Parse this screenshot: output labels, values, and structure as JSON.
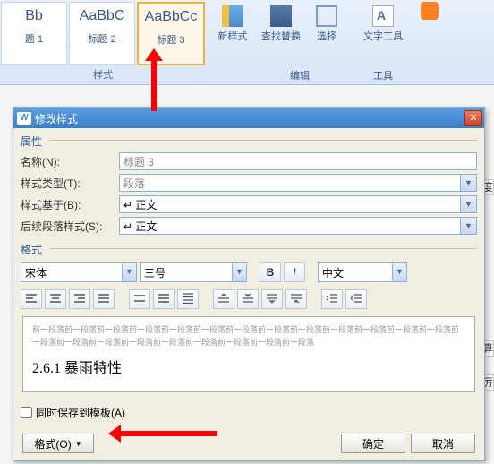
{
  "ribbon": {
    "styles": [
      {
        "sample": "Bb",
        "label": "题 1"
      },
      {
        "sample": "AaBbC",
        "label": "标题 2"
      },
      {
        "sample": "AaBbCc",
        "label": "标题 3"
      }
    ],
    "styles_group_label": "样式",
    "newstyle": "新样式",
    "findreplace": "查找替换",
    "select": "选择",
    "texttool": "文字工具",
    "edit_group": "编辑",
    "tool_group": "工具"
  },
  "dialog": {
    "title": "修改样式",
    "section_attr": "属性",
    "name_label": "名称(N):",
    "name_value": "标题 3",
    "styletype_label": "样式类型(T):",
    "styletype_value": "段落",
    "basedon_label": "样式基于(B):",
    "basedon_value": "↵ 正文",
    "followstyle_label": "后续段落样式(S):",
    "followstyle_value": "↵ 正文",
    "section_fmt": "格式",
    "font_value": "宋体",
    "size_value": "三号",
    "bold": "B",
    "italic": "I",
    "lang_value": "中文",
    "preview_filler": "前一段落前一段落前一段落前一段落前一段落前一段落前一段落前一段落前一段落前一段落前一段落前一段落前一段落前一段落前一段落前一段落前一段落前一段落前一段落前一段落前一段落前一段落",
    "preview_heading": "2.6.1 暴雨特性",
    "save_template": "同时保存到模板(A)",
    "format_btn": "格式(O)",
    "ok": "确定",
    "cancel": "取消"
  },
  "bg": {
    "c1": "度",
    "c2": "算",
    "c3": "厉"
  }
}
